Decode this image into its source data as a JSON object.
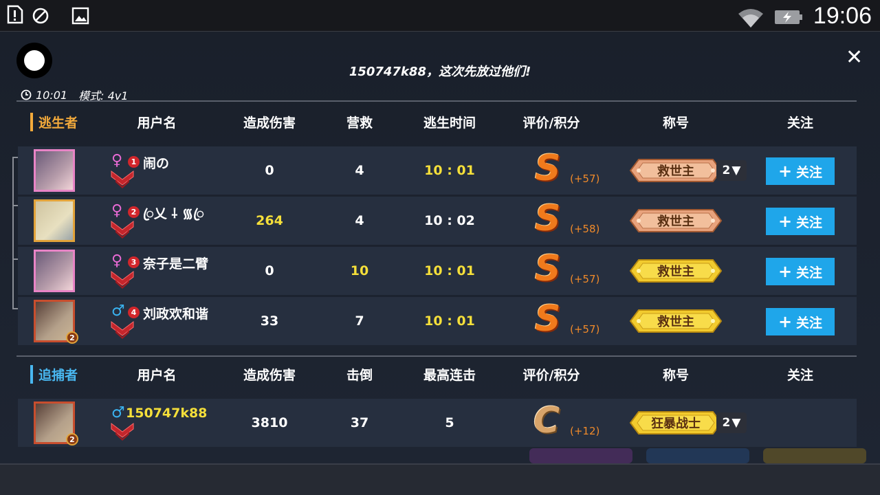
{
  "clock": "19:06",
  "title": "150747k88，这次先放过他们!",
  "meta": {
    "time": "10:01",
    "mode": "模式: 4v1"
  },
  "survivor_header": {
    "section": "逃生者",
    "username": "用户名",
    "damage": "造成伤害",
    "rescue": "营救",
    "escape_time": "逃生时间",
    "rating": "评价/积分",
    "title": "称号",
    "follow": "关注"
  },
  "survivors": [
    {
      "gender": "♀",
      "rank": "1",
      "name": "闹の",
      "damage": "0",
      "rescue": "4",
      "time": "10 : 01",
      "grade": "S",
      "points": "(+57)",
      "title": "救世主",
      "title_count": "2",
      "follow": "关注"
    },
    {
      "gender": "♀",
      "rank": "2",
      "name": "ꦿ乂 ⸸ ᯾ꦿ",
      "damage": "264",
      "rescue": "4",
      "time": "10 : 02",
      "grade": "S",
      "points": "(+58)",
      "title": "救世主",
      "follow": "关注"
    },
    {
      "gender": "♀",
      "rank": "3",
      "name": "奈子是二臂",
      "damage": "0",
      "rescue": "10",
      "time": "10 : 01",
      "grade": "S",
      "points": "(+57)",
      "title": "救世主",
      "follow": "关注"
    },
    {
      "gender": "♂",
      "rank": "4",
      "name": "刘政欢和谐",
      "damage": "33",
      "rescue": "7",
      "time": "10 : 01",
      "grade": "S",
      "points": "(+57)",
      "title": "救世主",
      "follow": "关注"
    }
  ],
  "hunter_header": {
    "section": "追捕者",
    "username": "用户名",
    "damage": "造成伤害",
    "knockdowns": "击倒",
    "combo": "最高连击",
    "rating": "评价/积分",
    "title": "称号",
    "follow": "关注"
  },
  "hunter": {
    "gender": "♂",
    "name": "150747k88",
    "damage": "3810",
    "knockdowns": "37",
    "combo": "5",
    "grade": "C",
    "points": "(+12)",
    "title": "狂暴战士",
    "title_count": "2",
    "avatar_badge": "2"
  },
  "avatar_badge": "2",
  "colors": {
    "survivor_accent": "#f2a93b",
    "hunter_accent": "#49b7f0",
    "highlight": "#f5df3a",
    "follow_button": "#1fa6ea"
  },
  "icons": [
    "warning-icon",
    "block-icon",
    "image-icon",
    "wifi-icon",
    "battery-icon",
    "clock-icon",
    "close-icon",
    "plus-icon",
    "chevron-down-icon"
  ]
}
